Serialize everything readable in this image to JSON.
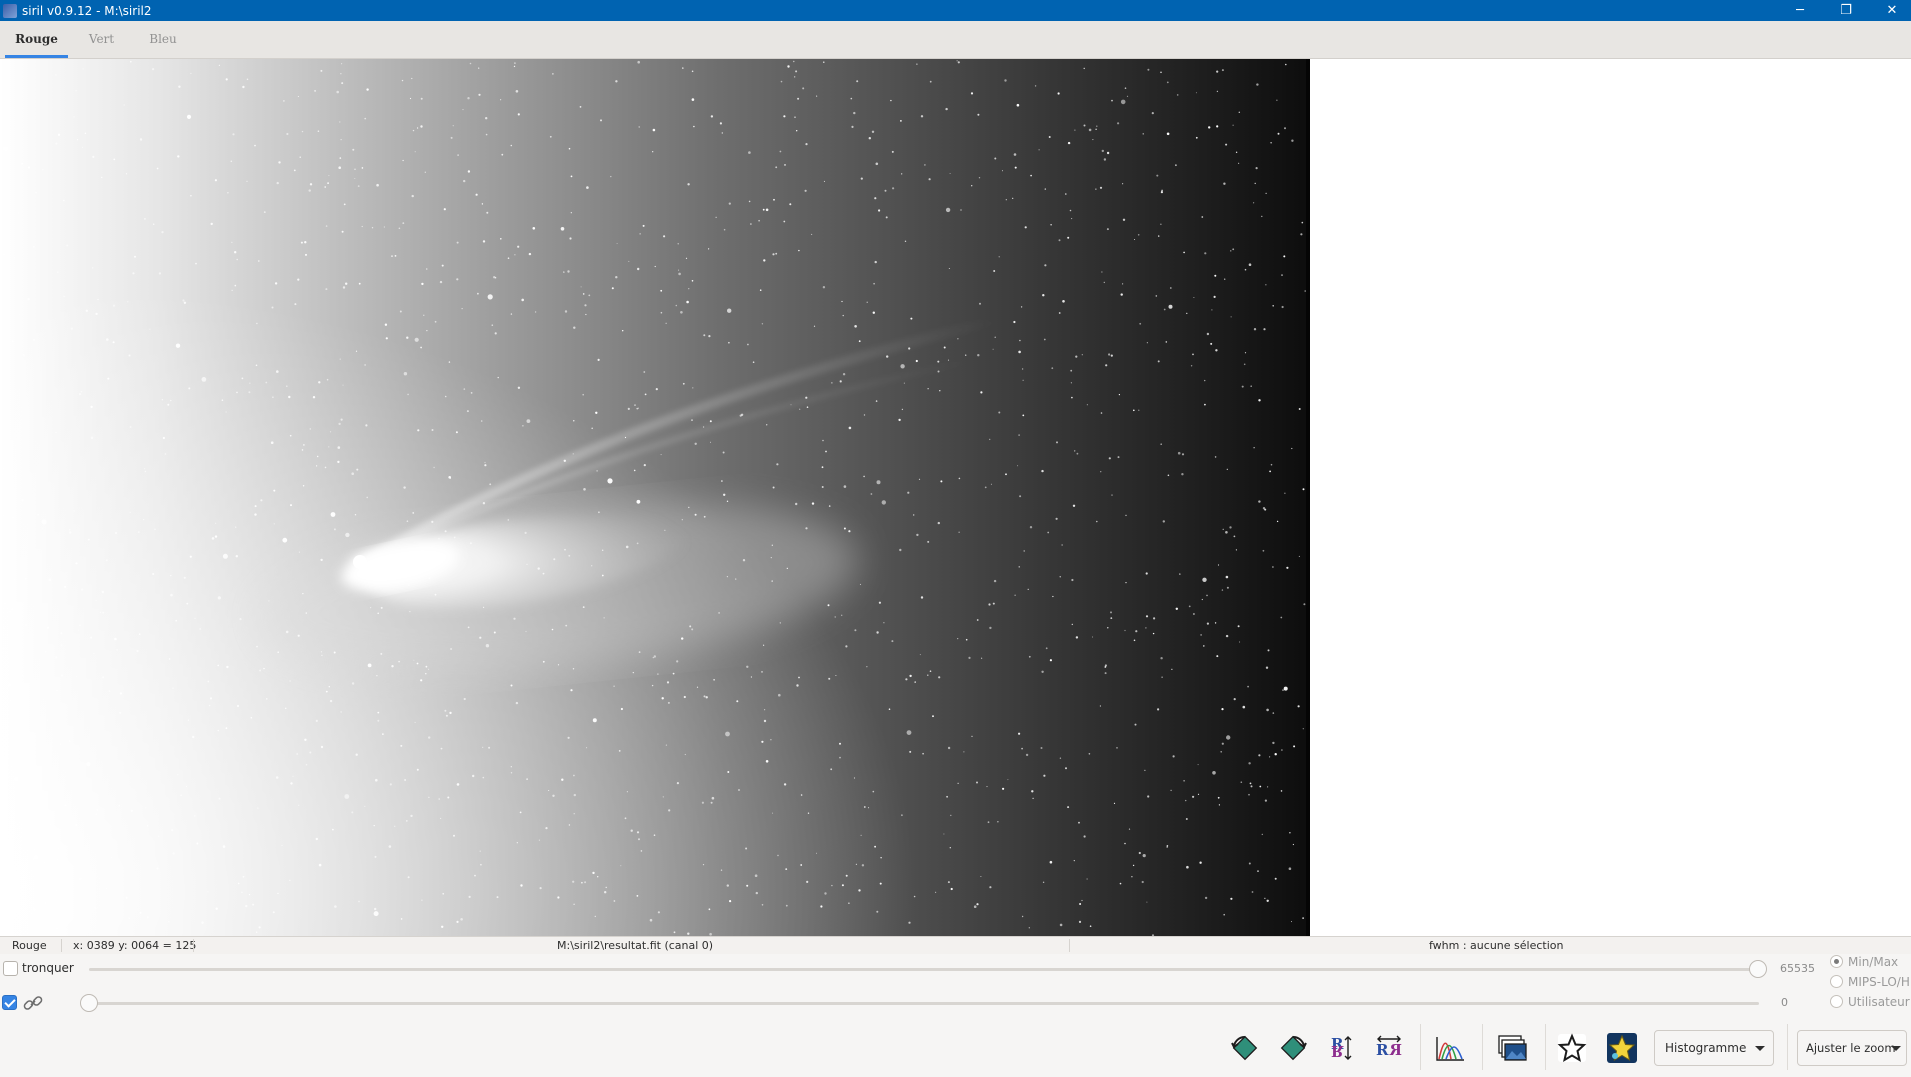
{
  "window": {
    "title": "siril v0.9.12 - M:\\siril2",
    "controls": {
      "minimize": "─",
      "restore": "❐",
      "close": "✕"
    }
  },
  "tabs": [
    {
      "label": "Rouge",
      "active": true
    },
    {
      "label": "Vert",
      "active": false
    },
    {
      "label": "Bleu",
      "active": false
    }
  ],
  "image": {
    "description_icon": "comet-image"
  },
  "status": {
    "channel": "Rouge",
    "coords": "x: 0389 y: 0064 = 125",
    "file": "M:\\siril2\\resultat.fit (canal 0)",
    "fwhm": "fwhm : aucune sélection"
  },
  "controls": {
    "clip_label": "tronquer",
    "clip_checked": false,
    "link_checked": true,
    "high_value": "65535",
    "low_value": "0",
    "modes": [
      {
        "label": "Min/Max",
        "checked": true
      },
      {
        "label": "MIPS-LO/HI",
        "checked": false
      },
      {
        "label": "Utilisateur",
        "checked": false
      }
    ]
  },
  "toolbar": {
    "icons": [
      "rotate-left-icon",
      "rotate-right-icon",
      "mirror-x-icon",
      "mirror-y-icon",
      "histogram-chart-icon",
      "image-stack-icon",
      "star-outline-icon",
      "star-colored-icon"
    ],
    "display_mode": "Histogramme",
    "zoom_mode": "Ajuster le zoom"
  },
  "colors": {
    "titlebar": "#0063b1",
    "accent": "#3584e4"
  }
}
